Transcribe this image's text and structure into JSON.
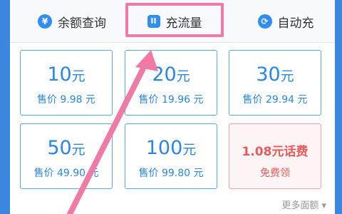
{
  "tabs": [
    {
      "label": "余额查询",
      "icon": "yen-icon"
    },
    {
      "label": "充流量",
      "icon": "pause-icon"
    },
    {
      "label": "自动充",
      "icon": "refresh-icon"
    }
  ],
  "cards": [
    {
      "amount": "10",
      "unit": "元",
      "price": "售价 9.98 元"
    },
    {
      "amount": "20",
      "unit": "元",
      "price": "售价 19.96 元"
    },
    {
      "amount": "30",
      "unit": "元",
      "price": "售价 29.94 元"
    },
    {
      "amount": "50",
      "unit": "元",
      "price": "售价 49.90 元"
    },
    {
      "amount": "100",
      "unit": "元",
      "price": "售价 99.80 元"
    }
  ],
  "promo": {
    "title": "1.08元话费",
    "subtitle": "免费领"
  },
  "more": "更多面额 ▾",
  "colors": {
    "accent": "#2b86e6",
    "highlight": "#ef7aa4",
    "promo": "#e95b5b"
  }
}
